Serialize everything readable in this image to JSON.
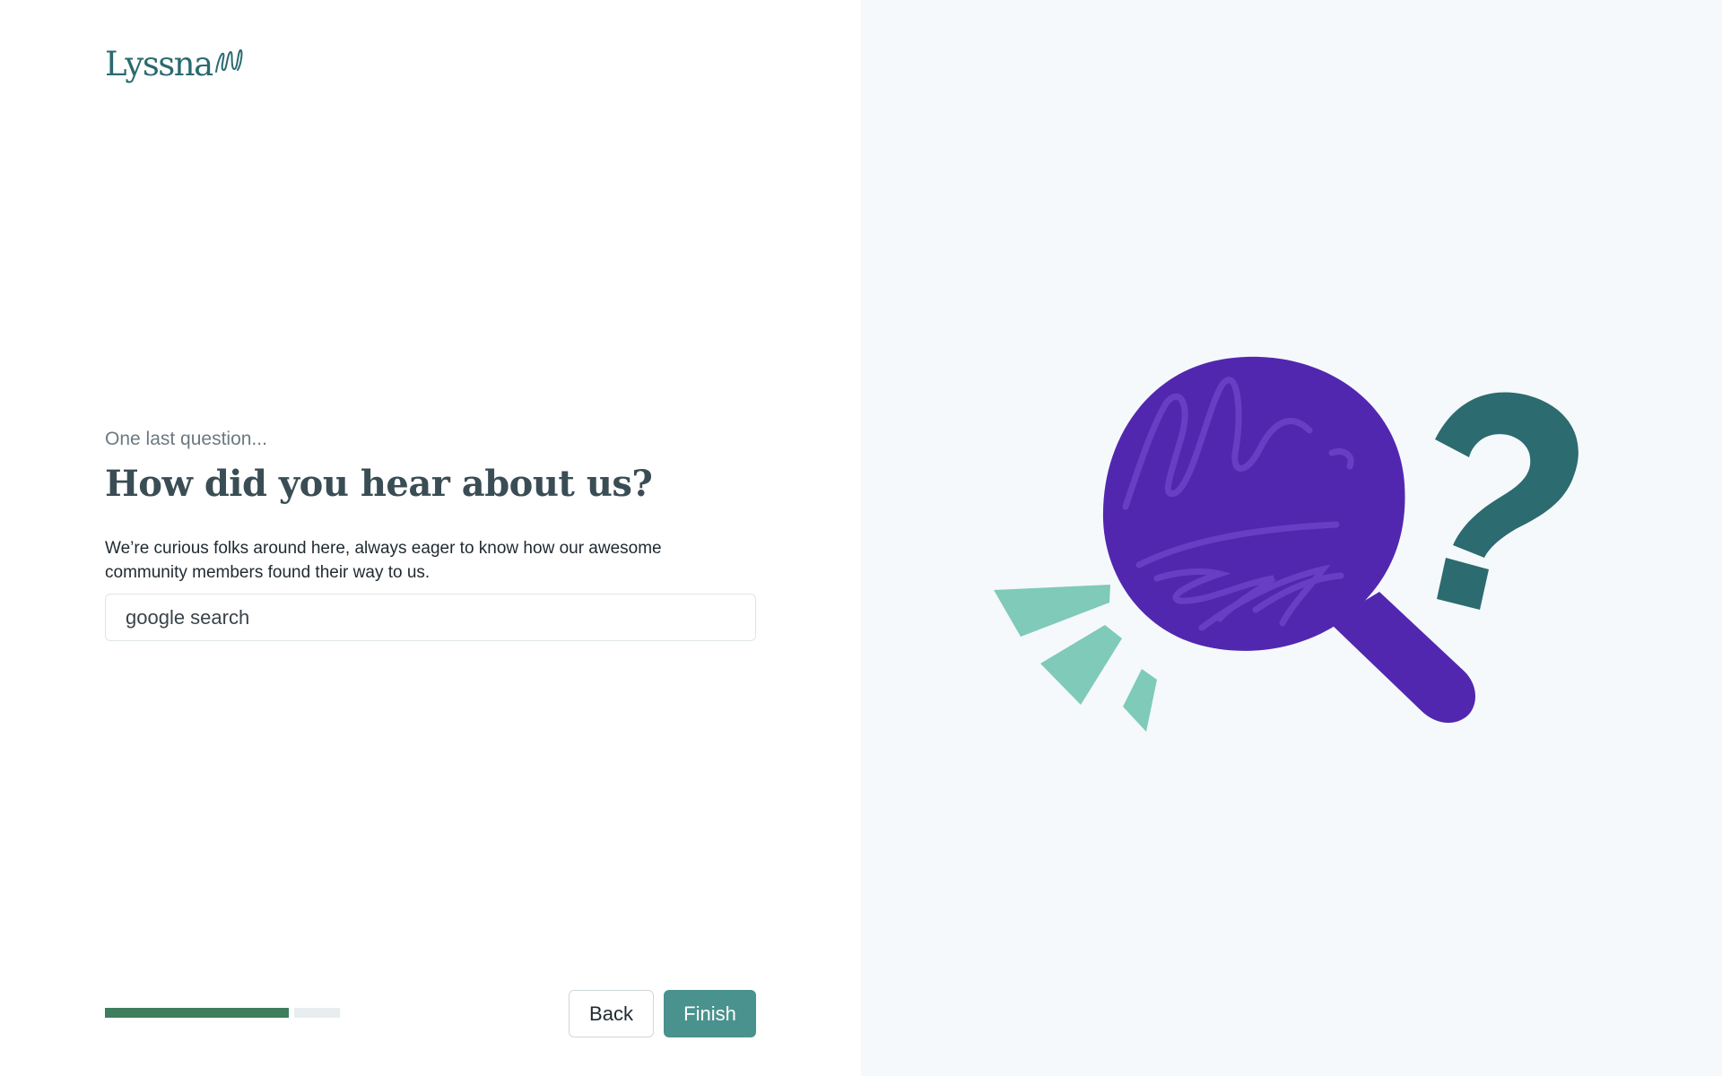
{
  "brand": {
    "name": "Lyssna",
    "color": "#2a6a70"
  },
  "form": {
    "eyebrow": "One last question...",
    "heading": "How did you hear about us?",
    "description": "We’re curious folks around here, always eager to know how our awesome community members found their way to us.",
    "answer_value": "google search"
  },
  "progress": {
    "fraction_complete": 0.8
  },
  "actions": {
    "back_label": "Back",
    "finish_label": "Finish"
  },
  "colors": {
    "accent": "#4a928d",
    "progress_fill": "#3e7d5e",
    "magnifier": "#5227b0",
    "question_mark": "#2c6b70",
    "rays": "#7fcab9",
    "illustration_background": "#f5f9fb"
  },
  "illustration": {
    "icons": [
      "magnifying-glass-icon",
      "question-mark-icon",
      "sparkle-rays-icon"
    ]
  }
}
